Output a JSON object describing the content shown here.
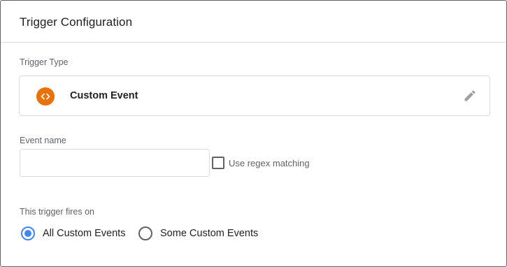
{
  "header": {
    "title": "Trigger Configuration"
  },
  "trigger_type": {
    "label": "Trigger Type",
    "name": "Custom Event",
    "icon": "code-brackets-icon",
    "icon_color": "#e8710a",
    "edit_icon": "pencil-icon"
  },
  "event_name": {
    "label": "Event name",
    "value": "",
    "placeholder": ""
  },
  "regex": {
    "label": "Use regex matching",
    "checked": false
  },
  "fires_on": {
    "label": "This trigger fires on",
    "options": [
      {
        "label": "All Custom Events",
        "selected": true
      },
      {
        "label": "Some Custom Events",
        "selected": false
      }
    ],
    "accent": "#4285f4"
  }
}
